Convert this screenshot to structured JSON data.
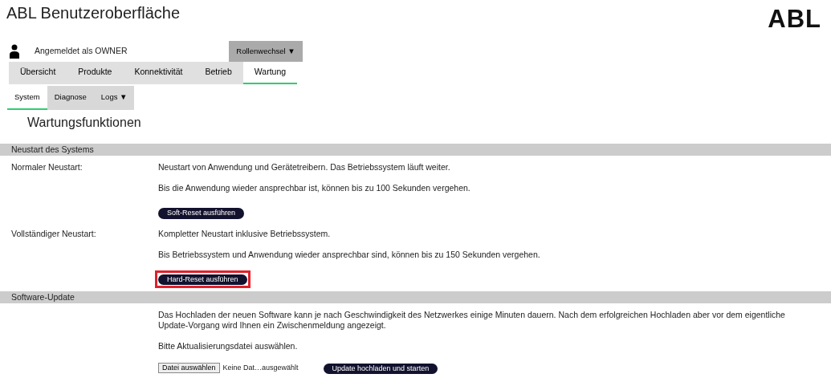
{
  "header": {
    "title": "ABL Benutzeroberfläche",
    "logo": "ABL"
  },
  "user": {
    "label": "Angemeldet als OWNER",
    "role_button": "Rollenwechsel ▼"
  },
  "tabs": [
    {
      "label": "Übersicht",
      "selected": false
    },
    {
      "label": "Produkte",
      "selected": false
    },
    {
      "label": "Konnektivität",
      "selected": false
    },
    {
      "label": "Betrieb",
      "selected": false
    },
    {
      "label": "Wartung",
      "selected": true
    }
  ],
  "subtabs": [
    {
      "label": "System",
      "selected": true
    },
    {
      "label": "Diagnose",
      "selected": false
    },
    {
      "label": "Logs ▼",
      "selected": false
    }
  ],
  "heading": "Wartungsfunktionen",
  "sections": [
    {
      "title": "Neustart des Systems",
      "rows": [
        {
          "label": "Normaler Neustart:",
          "lines": [
            "Neustart von Anwendung und Gerätetreibern. Das Betriebssystem läuft weiter.",
            "Bis die Anwendung wieder ansprechbar ist, können bis zu 100 Sekunden vergehen."
          ],
          "button": "Soft-Reset ausführen",
          "highlighted": false
        },
        {
          "label": "Vollständiger Neustart:",
          "lines": [
            "Kompletter Neustart inklusive Betriebssystem.",
            "Bis Betriebssystem und Anwendung wieder ansprechbar sind, können bis zu 150 Sekunden vergehen."
          ],
          "button": "Hard-Reset ausführen",
          "highlighted": true
        }
      ]
    },
    {
      "title": "Software-Update",
      "rows": [
        {
          "lines": [
            "Das Hochladen der neuen Software kann je nach Geschwindigkeit des Netzwerkes einige Minuten dauern. Nach dem erfolgreichen Hochladen aber vor dem eigentliche\nUpdate-Vorgang wird Ihnen ein Zwischenmeldung angezeigt.",
            "Bitte Aktualisierungsdatei auswählen."
          ],
          "file_button": "Datei auswählen",
          "file_status": "Keine Dat…ausgewählt",
          "button": "Update hochladen und starten",
          "highlighted": false
        }
      ]
    }
  ]
}
